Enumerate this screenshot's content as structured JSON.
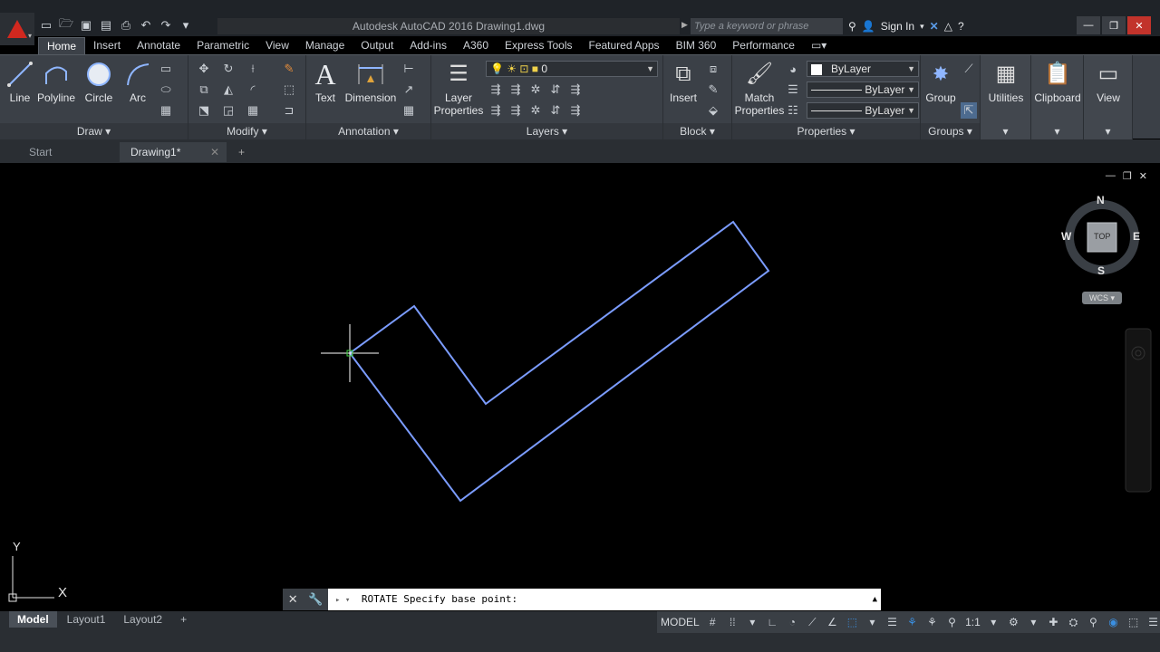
{
  "window": {
    "title": "Autodesk AutoCAD 2016    Drawing1.dwg",
    "search_placeholder": "Type a keyword or phrase",
    "sign_in": "Sign In"
  },
  "ribbon_tabs": [
    "Home",
    "Insert",
    "Annotate",
    "Parametric",
    "View",
    "Manage",
    "Output",
    "Add-ins",
    "A360",
    "Express Tools",
    "Featured Apps",
    "BIM 360",
    "Performance"
  ],
  "panels": {
    "draw": {
      "title": "Draw",
      "tools": [
        "Line",
        "Polyline",
        "Circle",
        "Arc"
      ]
    },
    "modify": {
      "title": "Modify"
    },
    "annotation": {
      "title": "Annotation",
      "text": "Text",
      "dimension": "Dimension"
    },
    "layers": {
      "title": "Layers",
      "layer_properties_1": "Layer",
      "layer_properties_2": "Properties",
      "current_layer": "0"
    },
    "block": {
      "title": "Block",
      "insert": "Insert"
    },
    "properties": {
      "title": "Properties",
      "match_1": "Match",
      "match_2": "Properties",
      "color": "ByLayer",
      "linetype": "ByLayer",
      "lineweight": "ByLayer"
    },
    "groups": {
      "title": "Groups",
      "group": "Group"
    },
    "utilities": "Utilities",
    "clipboard": "Clipboard",
    "view": "View"
  },
  "file_tabs": {
    "start": "Start",
    "doc": "Drawing1*"
  },
  "viewcube": {
    "n": "N",
    "s": "S",
    "e": "E",
    "w": "W",
    "face": "TOP",
    "wcs": "WCS"
  },
  "ucs": {
    "x": "X",
    "y": "Y"
  },
  "command": {
    "text": "ROTATE Specify base point:"
  },
  "layout_tabs": [
    "Model",
    "Layout1",
    "Layout2"
  ],
  "status": {
    "space": "MODEL",
    "scale": "1:1"
  },
  "colors": {
    "accent": "#d1281f",
    "geometry": "#6f8fff",
    "ribbon": "#3b4047"
  }
}
